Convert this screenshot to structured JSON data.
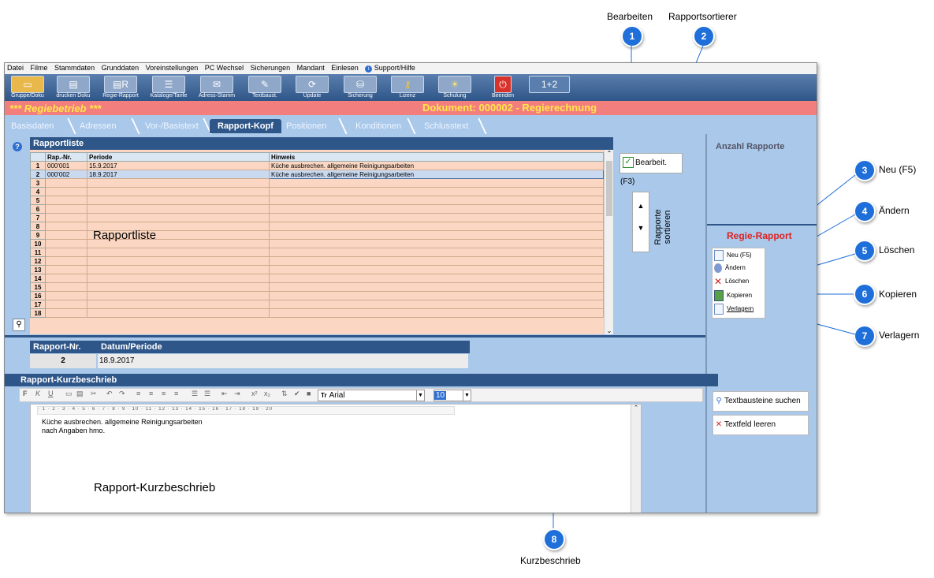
{
  "callouts": [
    {
      "n": "1",
      "label": "Bearbeiten"
    },
    {
      "n": "2",
      "label": "Rapportsortierer"
    },
    {
      "n": "3",
      "label": "Neu (F5)"
    },
    {
      "n": "4",
      "label": "Ändern"
    },
    {
      "n": "5",
      "label": "Löschen"
    },
    {
      "n": "6",
      "label": "Kopieren"
    },
    {
      "n": "7",
      "label": "Verlagern"
    },
    {
      "n": "8",
      "label": "Kurzbeschrieb"
    }
  ],
  "menu": [
    "Datei",
    "Filme",
    "Stammdaten",
    "Grunddaten",
    "Voreinstellungen",
    "PC Wechsel",
    "Sicherungen",
    "Mandant",
    "Einlesen",
    "Support/Hilfe"
  ],
  "toolbar": [
    {
      "label": "Gruppe/Doku",
      "icon": "folder-icon"
    },
    {
      "label": "drucken Doku",
      "icon": "printer-icon"
    },
    {
      "label": "Regie-Rapport",
      "icon": "printer-r-icon"
    },
    {
      "label": "Kataloge/Tarife",
      "icon": "catalog-icon"
    },
    {
      "label": "Adress-Stamm",
      "icon": "address-icon"
    },
    {
      "label": "Textbaust.",
      "icon": "text-icon"
    },
    {
      "label": "Update",
      "icon": "update-icon"
    },
    {
      "label": "Sicherung",
      "icon": "backup-icon"
    },
    {
      "label": "Lizenz",
      "icon": "key-icon"
    },
    {
      "label": "Schulung",
      "icon": "bulb-icon"
    },
    {
      "label": "Beenden",
      "icon": "power-icon"
    },
    {
      "label": "1+2",
      "icon": "calc-icon"
    }
  ],
  "status": {
    "left": "*** Regiebetrieb ***",
    "right": "Dokument: 000002 - Regierechnung"
  },
  "tabs": [
    "Basisdaten",
    "Adressen",
    "Vor-/Basistext",
    "Rapport-Kopf",
    "Positionen",
    "Konditionen",
    "Schlusstext"
  ],
  "rapportliste": {
    "title": "Rapportliste",
    "overlay": "Rapportliste",
    "columns": [
      "Rap.-Nr.",
      "Periode",
      "Hinweis"
    ],
    "rows": [
      {
        "nr": "1",
        "rap": "000'001",
        "periode": "15.9.2017",
        "hinweis": "Küche ausbrechen. allgemeine Reinigungsarbeiten"
      },
      {
        "nr": "2",
        "rap": "000'002",
        "periode": "18.9.2017",
        "hinweis": "Küche ausbrechen. allgemeine Reinigungsarbeiten"
      }
    ],
    "empty_rows": [
      "3",
      "4",
      "5",
      "6",
      "7",
      "8",
      "9",
      "10",
      "11",
      "12",
      "13",
      "14",
      "15",
      "16",
      "17",
      "18"
    ]
  },
  "bearbeiten_label": "Bearbeit. (F3)",
  "sort_label": "Rapporte sortieren",
  "anzahl_label": "Anzahl Rapporte",
  "regie": {
    "title": "Regie-Rapport",
    "buttons": [
      "Neu (F5)",
      "Ändern",
      "Löschen",
      "Kopieren",
      "Verlagern"
    ]
  },
  "info": {
    "nr_header": "Rapport-Nr.",
    "datum_header": "Datum/Periode",
    "nr": "2",
    "datum": "18.9.2017"
  },
  "kurz": {
    "title": "Rapport-Kurzbeschrieb",
    "font": "Arial",
    "size": "10",
    "line1": "Küche ausbrechen. allgemeine Reinigungsarbeiten",
    "line2": "nach Angaben hmo.",
    "overlay": "Rapport-Kurzbeschrieb"
  },
  "text_buttons": [
    "Textbausteine suchen",
    "Textfeld leeren"
  ]
}
